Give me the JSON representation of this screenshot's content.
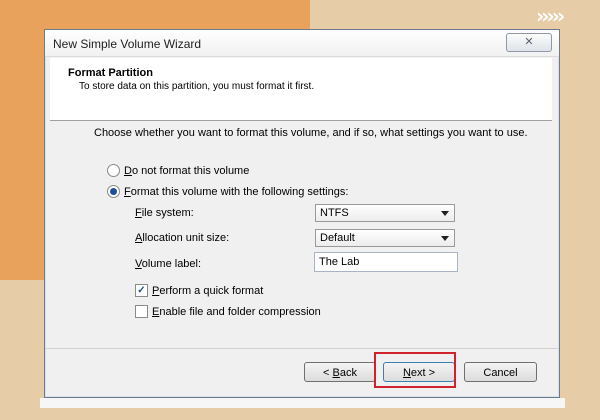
{
  "background": {
    "arrows_text": "›››››",
    "colors": {
      "page": "#e6cda7",
      "orange_shape": "#e8a25c",
      "highlight": "#d0222d"
    }
  },
  "dialog": {
    "title": "New Simple Volume Wizard",
    "close_label": "✕",
    "header": {
      "title": "Format Partition",
      "subtitle": "To store data on this partition, you must format it first."
    },
    "instruction": "Choose whether you want to format this volume, and if so, what settings you want to use.",
    "options": {
      "no_format": {
        "label_first": "D",
        "label_rest": "o not format this volume",
        "selected": false
      },
      "format": {
        "label_first": "F",
        "label_rest": "ormat this volume with the following settings:",
        "selected": true
      }
    },
    "fields": {
      "file_system": {
        "label_first": "F",
        "label_rest": "ile system:",
        "value": "NTFS"
      },
      "allocation": {
        "label_first": "A",
        "label_rest": "llocation unit size:",
        "value": "Default"
      },
      "volume_label": {
        "label_first": "V",
        "label_rest": "olume label:",
        "value": "The Lab"
      }
    },
    "checks": {
      "quick_format": {
        "label_first": "P",
        "label_rest": "erform a quick format",
        "checked": true,
        "mark": "✓"
      },
      "compression": {
        "label_first": "E",
        "label_rest": "nable file and folder compression",
        "checked": false
      }
    },
    "buttons": {
      "back": {
        "prefix": "< ",
        "first": "B",
        "rest": "ack"
      },
      "next": {
        "first": "N",
        "rest": "ext >"
      },
      "cancel": "Cancel"
    }
  }
}
